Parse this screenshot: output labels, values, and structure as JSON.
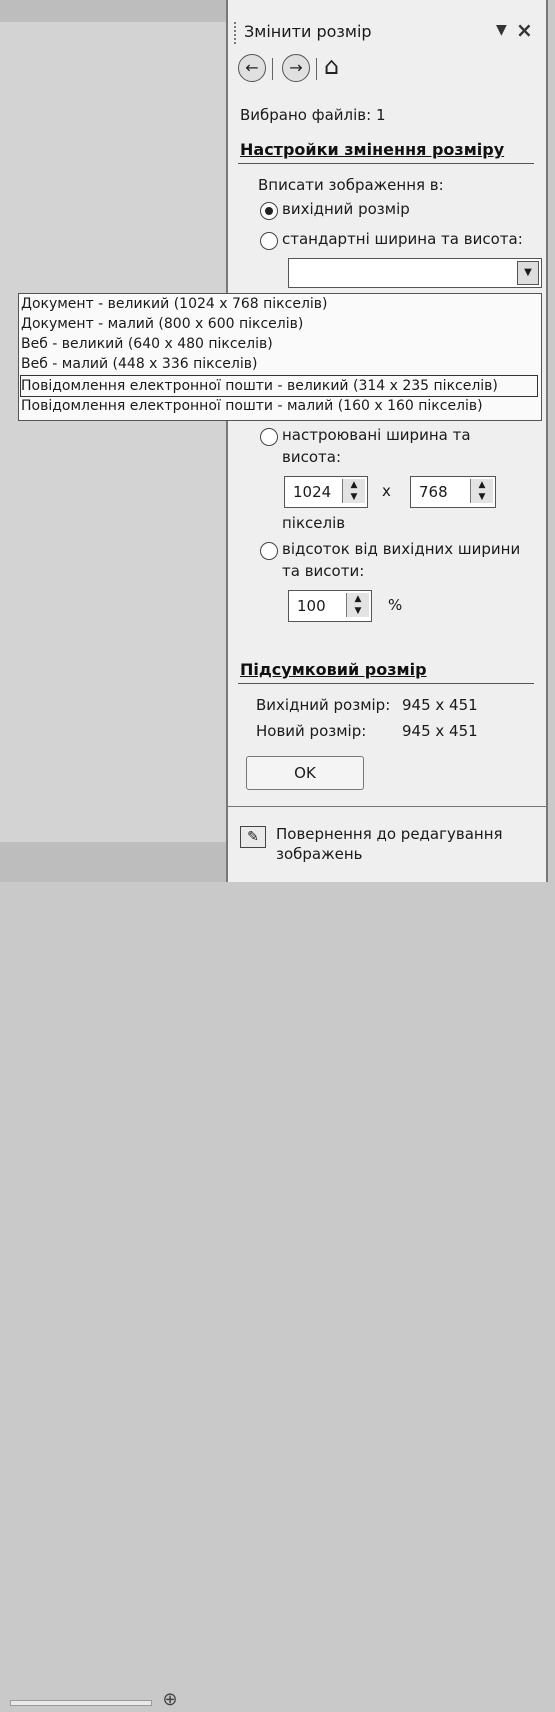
{
  "pane": {
    "title": "Змінити розмір"
  },
  "nav": {
    "back": "←",
    "forward": "→",
    "home": "⌂"
  },
  "selected_files": "Вибрано файлів: 1",
  "resize_settings": {
    "title": "Настройки змінення розміру",
    "fit_label": "Вписати зображення в:",
    "option_original": "вихідний розмір",
    "option_standard": "стандартні ширина та висота:",
    "preset_value": "",
    "dropdown": [
      "Документ - великий (1024 x 768 пікселів)",
      "Документ - малий (800 x 600 пікселів)",
      "Веб - великий (640 x 480 пікселів)",
      "Веб - малий (448 x 336 пікселів)",
      "Повідомлення електронної пошти - великий (314 x 235 пікселів)",
      "Повідомлення електронної пошти - малий (160 x 160 пікселів)"
    ],
    "option_custom_line1": "настроювані ширина та",
    "option_custom_line2": "висота:",
    "width_value": "1024",
    "times": "x",
    "height_value": "768",
    "pixels_label": "пікселів",
    "option_percent_line1": "відсоток від вихідних ширини",
    "option_percent_line2": "та висоти:",
    "percent_value": "100",
    "percent_sign": "%"
  },
  "summary": {
    "title": "Підсумковий розмір",
    "original_label": "Вихідний розмір:",
    "original_value": "945 x 451",
    "new_label": "Новий розмір:",
    "new_value": "945 x 451"
  },
  "ok_label": "OK",
  "back_to_edit": "Повернення до редагування зображень",
  "icons": {
    "close": "close-icon",
    "menu": "chevron-down-icon",
    "zoom": "zoom-in-icon",
    "edit": "edit-picture-icon"
  }
}
